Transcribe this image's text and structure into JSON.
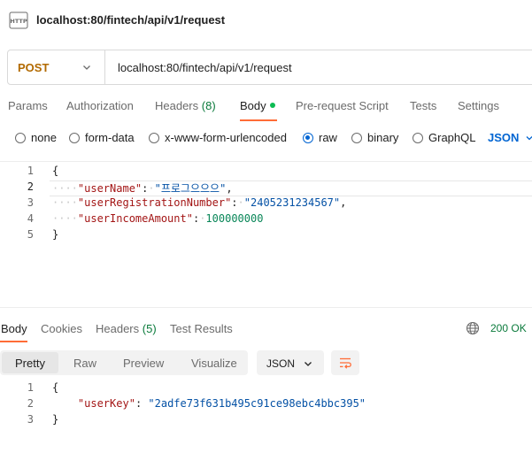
{
  "window": {
    "icon_label": "HTTP",
    "title": "localhost:80/fintech/api/v1/request"
  },
  "request": {
    "method": "POST",
    "url": "localhost:80/fintech/api/v1/request",
    "tabs": [
      {
        "label": "Params"
      },
      {
        "label": "Authorization"
      },
      {
        "label": "Headers",
        "count": "(8)"
      },
      {
        "label": "Body"
      },
      {
        "label": "Pre-request Script"
      },
      {
        "label": "Tests"
      },
      {
        "label": "Settings"
      }
    ],
    "active_tab": "Body",
    "body_types": [
      "none",
      "form-data",
      "x-www-form-urlencoded",
      "raw",
      "binary",
      "GraphQL"
    ],
    "selected_body_type": "raw",
    "language": "JSON",
    "line_numbers": [
      "1",
      "2",
      "3",
      "4",
      "5"
    ],
    "body_lines": [
      {
        "open": "{"
      },
      {
        "key": "\"userName\"",
        "value": "\"프로그으으으\"",
        "trail": ","
      },
      {
        "key": "\"userRegistrationNumber\"",
        "value": "\"2405231234567\"",
        "trail": ","
      },
      {
        "key": "\"userIncomeAmount\"",
        "value": "100000000",
        "trail": ""
      },
      {
        "close": "}"
      }
    ]
  },
  "response": {
    "tabs": [
      {
        "label": "Body"
      },
      {
        "label": "Cookies"
      },
      {
        "label": "Headers",
        "count": "(5)"
      },
      {
        "label": "Test Results"
      }
    ],
    "active_tab": "Body",
    "status": "200 OK",
    "view_modes": [
      "Pretty",
      "Raw",
      "Preview",
      "Visualize"
    ],
    "active_view": "Pretty",
    "format": "JSON",
    "line_numbers": [
      "1",
      "2",
      "3"
    ],
    "body_lines": [
      {
        "open": "{"
      },
      {
        "key": "\"userKey\"",
        "value": "\"2adfe73f631b495c91ce98ebc4bbc395\""
      },
      {
        "close": "}"
      }
    ]
  },
  "colors": {
    "accent": "#ff6c37",
    "method": "#b26a00",
    "link_blue": "#0265d2",
    "success_green": "#0a7a3b",
    "json_key": "#a31515",
    "json_string": "#0451a5",
    "json_number": "#098658"
  }
}
